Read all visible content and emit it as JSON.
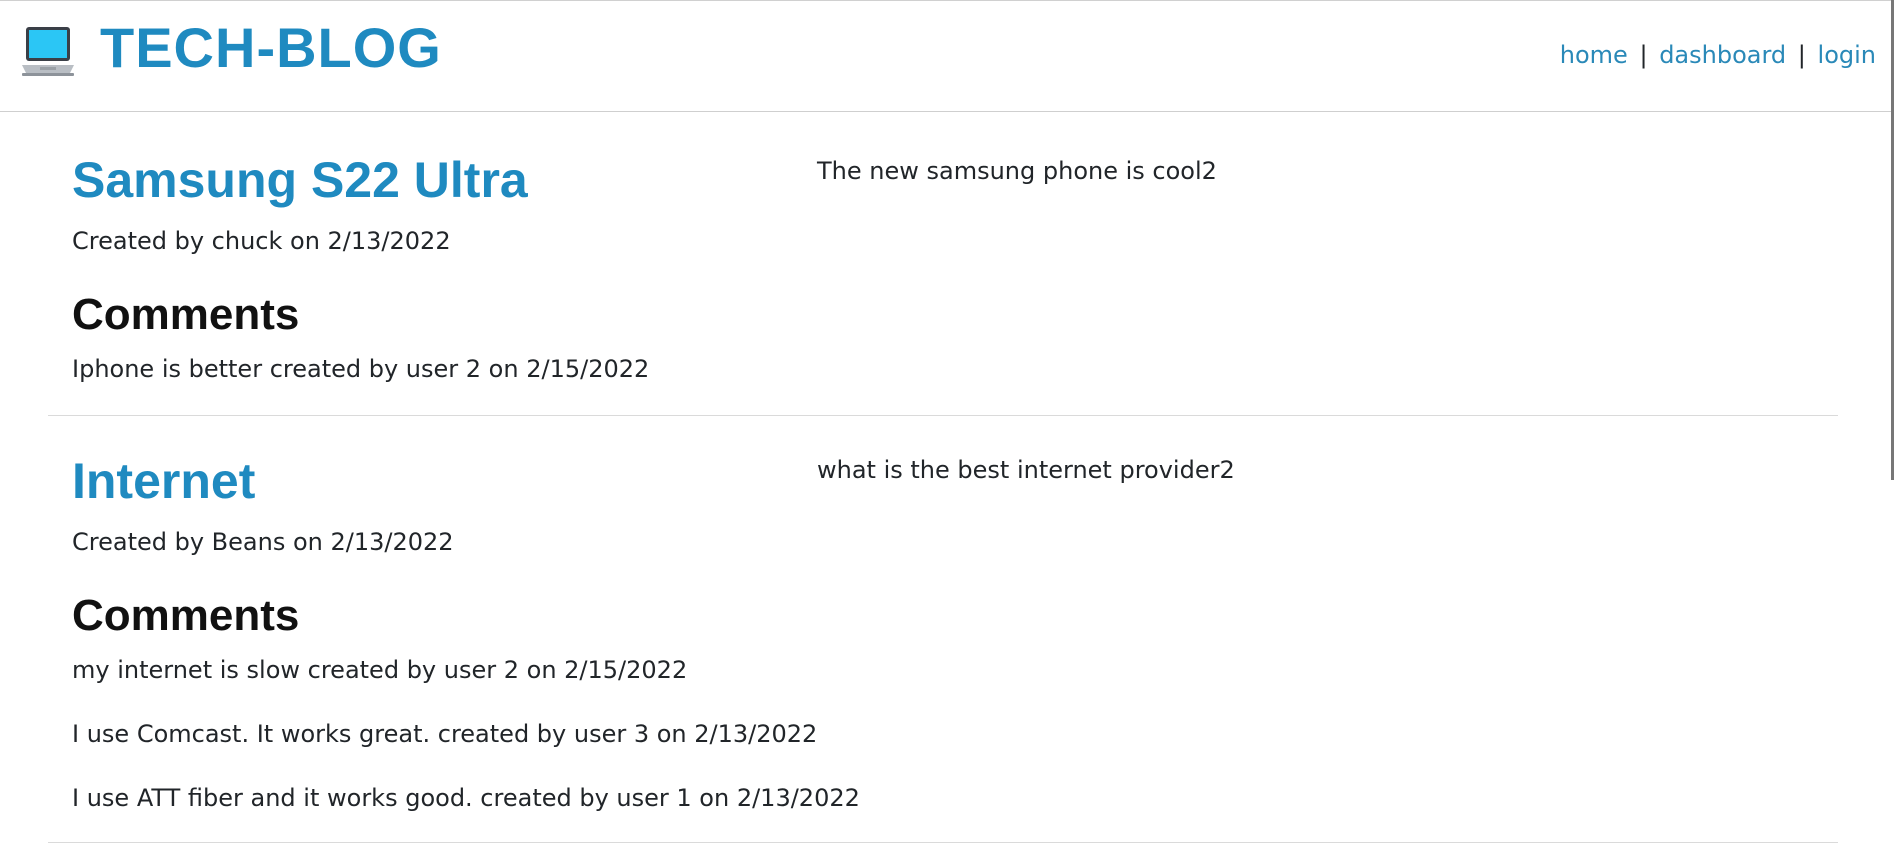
{
  "header": {
    "logo_icon": "laptop-icon",
    "brand": "TECH-BLOG",
    "nav": {
      "home": "home",
      "dashboard": "dashboard",
      "login": "login",
      "separator": "|"
    }
  },
  "posts": [
    {
      "title": "Samsung S22 Ultra",
      "meta": "Created by chuck on 2/13/2022",
      "body": "The new samsung phone is cool2",
      "comments_heading": "Comments",
      "comments": [
        "Iphone is better created by user 2 on 2/15/2022"
      ]
    },
    {
      "title": "Internet",
      "meta": "Created by Beans on 2/13/2022",
      "body": "what is the best internet provider2",
      "comments_heading": "Comments",
      "comments": [
        "my internet is slow created by user 2 on 2/15/2022",
        "I use Comcast. It works great. created by user 3 on 2/13/2022",
        "I use ATT fiber and it works good. created by user 1 on 2/13/2022"
      ]
    }
  ],
  "colors": {
    "accent": "#1f8ac0",
    "link": "#2a89b8",
    "text": "#212529"
  }
}
